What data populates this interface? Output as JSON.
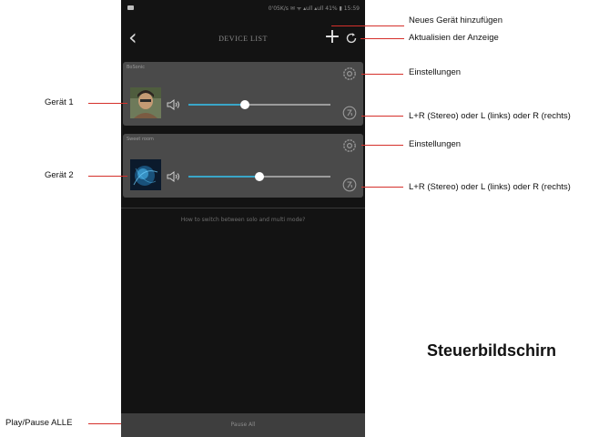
{
  "phone": {
    "status_bar_text": "0'05K/s ✉ ᯤ ▴ull ▴ull 41% ▮ 15:59",
    "title": "DEVICE LIST",
    "back_icon": "chevron-left-icon",
    "add_icon": "plus-icon",
    "refresh_icon": "refresh-icon",
    "hint": "How to switch between solo and multi mode?",
    "pause_all": "Pause All"
  },
  "devices": [
    {
      "name": "BoSonic",
      "volume": 0.4,
      "thumb": "portrait-photo",
      "accent": "#3aa6c8"
    },
    {
      "name": "Sweet room",
      "volume": 0.5,
      "thumb": "blue-abstract",
      "accent": "#3aa6c8"
    }
  ],
  "annotations": {
    "add_device": "Neues Gerät hinzufügen",
    "refresh": "Aktualisien der Anzeige",
    "settings_1": "Einstellungen",
    "channel_1": "L+R (Stereo) oder L (links) oder R (rechts)",
    "settings_2": "Einstellungen",
    "channel_2": "L+R (Stereo) oder L (links) oder R (rechts)",
    "device_1": "Gerät 1",
    "device_2": "Gerät 2",
    "pause_all": "Play/Pause ALLE",
    "screen_title": "Steuerbildschirn"
  },
  "colors": {
    "annotation_line": "#d5302b",
    "slider_fill": "#3aa6c8",
    "card": "#4a4a4a",
    "screen": "#131313"
  }
}
